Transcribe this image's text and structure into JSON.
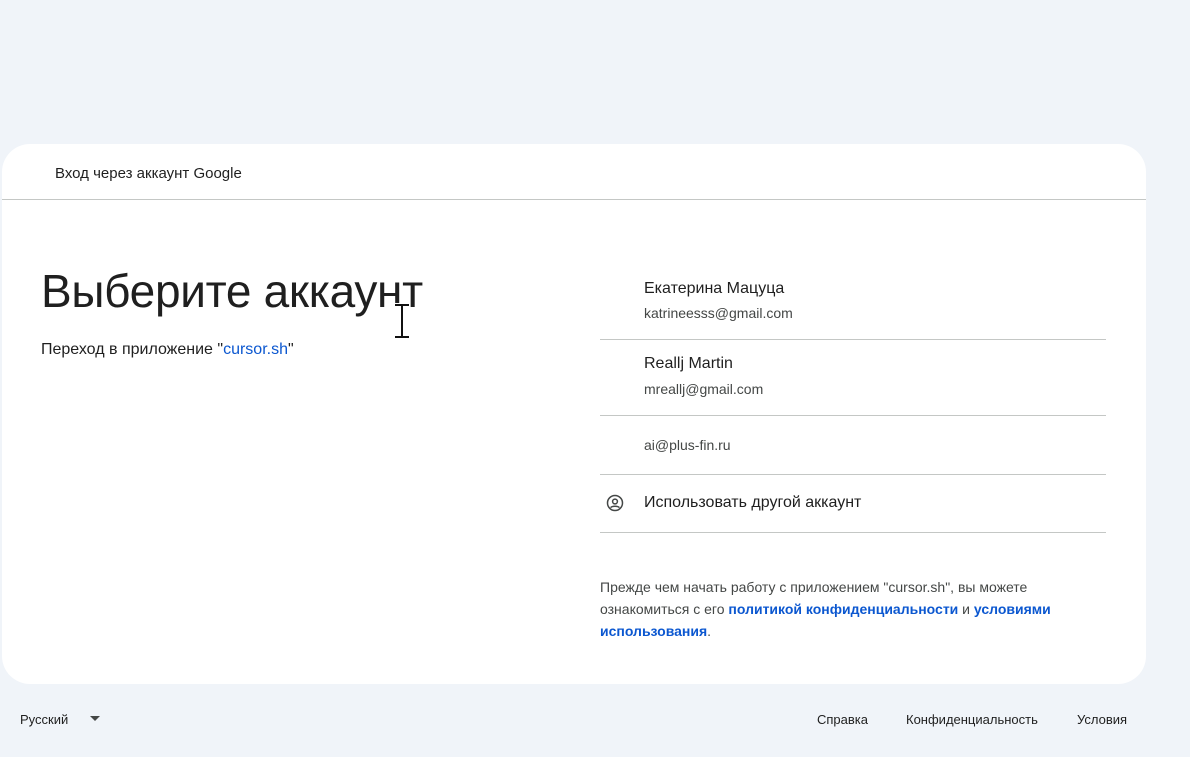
{
  "header": {
    "title": "Вход через аккаунт Google"
  },
  "main": {
    "heading": "Выберите аккаунт",
    "subtitle_prefix": "Переход в приложение \"",
    "app_name": "cursor.sh",
    "subtitle_suffix": "\""
  },
  "accounts": [
    {
      "name": "Екатерина Мацуца",
      "email": "katrineesss@gmail.com"
    },
    {
      "name": "Reallj Martin",
      "email": "mreallj@gmail.com"
    },
    {
      "email": "ai@plus-fin.ru"
    }
  ],
  "other_account": {
    "label": "Использовать другой аккаунт",
    "icon": "account-circle-icon"
  },
  "privacy": {
    "text_1": "Прежде чем начать работу с приложением \"cursor.sh\", вы можете ознакомиться с его ",
    "privacy_link": "политикой конфиденциальности",
    "text_2": " и ",
    "terms_link": "условиями использования",
    "text_3": "."
  },
  "footer": {
    "language": "Русский",
    "help": "Справка",
    "privacy": "Конфиденциальность",
    "terms": "Условия"
  },
  "colors": {
    "accent": "#0b57d0",
    "background": "#f0f4f9",
    "card": "#ffffff"
  }
}
